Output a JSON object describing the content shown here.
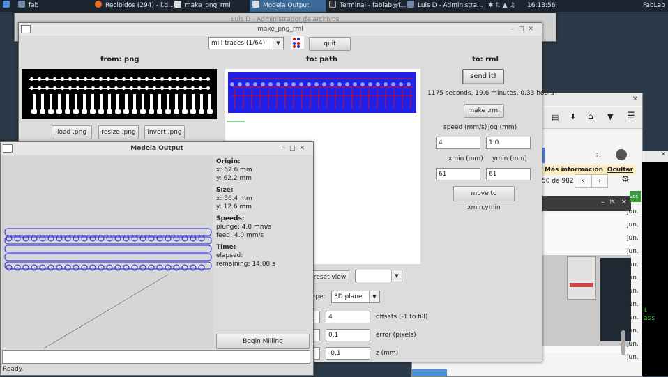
{
  "taskbar": {
    "items": [
      {
        "label": "fab"
      },
      {
        "label": "Recibidos (294) - l.d..."
      },
      {
        "label": "make_png_rml"
      },
      {
        "label": "Modela Output"
      },
      {
        "label": "Terminal - fablab@f..."
      },
      {
        "label": "Luis D - Administra..."
      }
    ],
    "clock": "16:13:56",
    "user": "FabLab"
  },
  "file_manager": {
    "title": "Luis D - Administrador de archivos"
  },
  "make_png": {
    "title": "make_png_rml",
    "mode_select": "mill traces (1/64)",
    "quit_label": "quit",
    "from_header": "from: png",
    "to_path_header": "to: path",
    "to_rml_header": "to: rml",
    "load_label": "load .png",
    "resize_label": "resize .png",
    "invert_label": "invert .png",
    "send_label": "send it!",
    "estimate": "1175 seconds, 19.6 minutes, 0.33 hours",
    "make_rml_label": "make .rml",
    "speed_label": "speed (mm/s)",
    "jog_label": "jog (mm)",
    "speed_value": "4",
    "jog_value": "1.0",
    "xmin_label": "xmin (mm)",
    "ymin_label": "ymin (mm)",
    "xmin_value": "61",
    "ymin_value": "61",
    "move_label": "move to xmin,ymin",
    "reset_view_label": "reset view",
    "type_label": "ype:",
    "type_value": "3D plane",
    "offsets_value": "4",
    "offsets_label": "offsets (-1 to fill)",
    "error_value": "0.1",
    "error_label": "error (pixels)",
    "z_value": "-0.1",
    "z_label": "z (mm)"
  },
  "modela": {
    "title": "Modela Output",
    "origin_header": "Origin:",
    "origin_x": "x: 62.6 mm",
    "origin_y": "y: 62.2 mm",
    "size_header": "Size:",
    "size_x": "x: 56.4 mm",
    "size_y": "y: 12.6 mm",
    "speeds_header": "Speeds:",
    "plunge": "plunge: 4.0 mm/s",
    "feed": "feed: 4.0 mm/s",
    "time_header": "Time:",
    "elapsed": "elapsed:",
    "remaining": "remaining: 14:00 s",
    "begin_label": "Begin Milling",
    "status": "Ready."
  },
  "browser": {
    "info_label": "Más información",
    "hide_label": "Ocultar",
    "pager": "50 de 982",
    "tag": "vos",
    "row_labels": [
      "jun.",
      "jun.",
      "jun.",
      "jun.",
      "jun.",
      "jun.",
      "jun.",
      "jun.",
      "jun.",
      "jun.",
      "jun.",
      "jun."
    ]
  },
  "terminal": {
    "line1": "t",
    "line2": "ass"
  },
  "colors": {
    "path_blue": "#2020e6",
    "path_red": "#e01010",
    "taskbar": "#1d2630"
  }
}
